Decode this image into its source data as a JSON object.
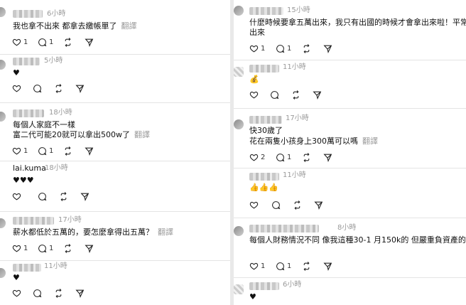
{
  "left": [
    {
      "time": "6小時",
      "text": "我也拿不出來 都拿去繳帳單了",
      "translate": "翻譯",
      "counts": {
        "like": "1",
        "reply": "1"
      }
    },
    {
      "time": "5小時",
      "text": "♥",
      "translate": "",
      "counts": {
        "like": "",
        "reply": ""
      }
    },
    {
      "time": "18小時",
      "text": "每個人家庭不一樣",
      "text2": "富二代可能20就可以拿出500w了",
      "translate": "翻譯",
      "counts": {
        "like": "1",
        "reply": "1"
      }
    },
    {
      "username": "lai.kuma",
      "time": "18小時",
      "text": "♥♥♥",
      "translate": "",
      "counts": {
        "like": "",
        "reply": ""
      }
    },
    {
      "time": "17小時",
      "text": "薪水都低於五萬的，要怎麼拿得出五萬？",
      "translate": "翻譯",
      "counts": {
        "like": "1",
        "reply": "1"
      }
    },
    {
      "time": "11小時",
      "text": "♥",
      "translate": "",
      "counts": {
        "like": "",
        "reply": ""
      }
    }
  ],
  "right": [
    {
      "time": "15小時",
      "text": "什麼時候要拿五萬出來，我只有出國的時候才會拿出來啦！平常都不",
      "text2": "出來",
      "translate": "翻譯",
      "counts": {
        "like": "1",
        "reply": "1"
      }
    },
    {
      "time": "11小時",
      "text": "💰",
      "translate": "",
      "counts": {
        "like": "",
        "reply": ""
      }
    },
    {
      "time": "17小時",
      "text": "快30歲了",
      "text2": "花在兩隻小孩身上300萬可以嗎",
      "translate": "翻譯",
      "counts": {
        "like": "2",
        "reply": "1"
      }
    },
    {
      "time": "11小時",
      "text": "👍👍👍",
      "translate": "",
      "counts": {
        "like": "",
        "reply": ""
      }
    },
    {
      "time": "8小時",
      "text": "每個人財務情況不同 像我這種30-1 月150k的 但嚴重負資產的人 的話",
      "translate": "",
      "counts": {
        "like": "1",
        "reply": "1"
      }
    },
    {
      "time": "6小時",
      "text": "♥",
      "translate": "",
      "counts": {
        "like": "",
        "reply": ""
      }
    }
  ],
  "icons": [
    "heart-icon",
    "reply-icon",
    "repost-icon",
    "share-icon"
  ]
}
